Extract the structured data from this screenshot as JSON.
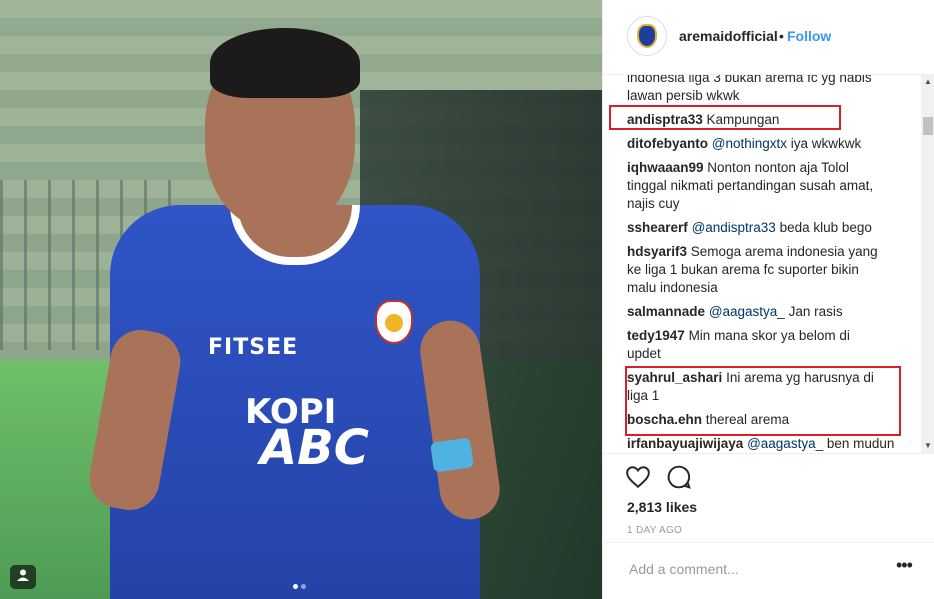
{
  "post_image": {
    "jersey_sponsor": "FITSEE",
    "jersey_text_1": "KOPI",
    "jersey_text_2": "ABC"
  },
  "header": {
    "username": "aremaidofficial",
    "separator": "•",
    "follow_label": "Follow"
  },
  "comments": [
    {
      "user": "",
      "mention": "",
      "text": "indonesia liga 3 bukan arema fc yg habis",
      "text2": "lawan persib wkwk"
    },
    {
      "user": "andisptra33",
      "mention": "",
      "text": "Kampungan"
    },
    {
      "user": "ditofebyanto",
      "mention": "@nothingxtx",
      "text": "iya wkwkwk"
    },
    {
      "user": "iqhwaaan99",
      "mention": "",
      "text": "Nonton nonton aja Tolol",
      "text2": "tinggal nikmati pertandingan susah amat,",
      "text3": "najis cuy"
    },
    {
      "user": "sshearerf",
      "mention": "@andisptra33",
      "text": "beda klub bego"
    },
    {
      "user": "hdsyarif3",
      "mention": "",
      "text": "Semoga arema indonesia yang",
      "text2": "ke liga 1 bukan arema fc suporter bikin",
      "text3": "malu indonesia"
    },
    {
      "user": "salmannade",
      "mention": "@aagastya_",
      "text": "Jan rasis"
    },
    {
      "user": "tedy1947",
      "mention": "",
      "text": "Min mana skor ya belom di",
      "text2": "updet"
    },
    {
      "user": "syahrul_ashari",
      "mention": "",
      "text": "Ini arema yg harusnya di",
      "text2": "liga 1"
    },
    {
      "user": "boscha.ehn",
      "mention": "",
      "text": "thereal arema"
    },
    {
      "user": "irfanbayuajiwijaya",
      "mention": "@aagastya_",
      "text": "ben mudun"
    }
  ],
  "likes": "2,813 likes",
  "date": "1 DAY AGO",
  "add_comment": {
    "placeholder": "Add a comment..."
  },
  "more_label": "•••",
  "colors": {
    "follow": "#3897f0",
    "highlight": "#d6202a",
    "jersey": "#2f55c6"
  }
}
